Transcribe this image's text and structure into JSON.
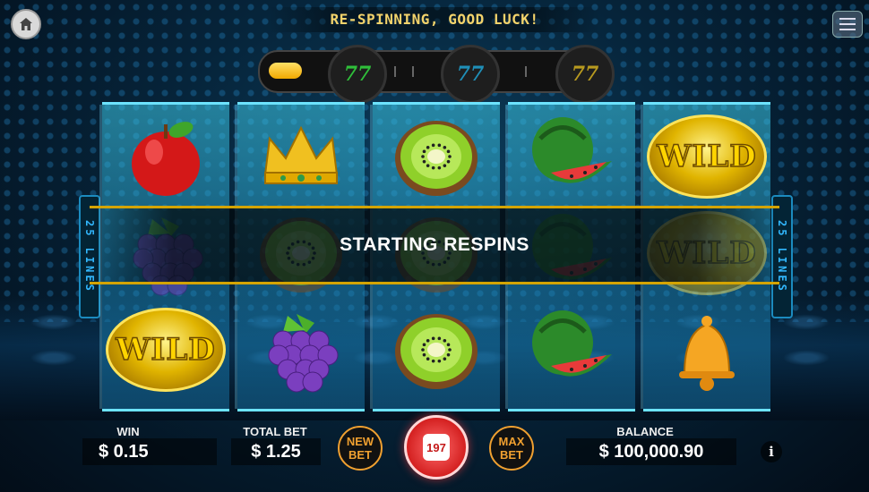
{
  "header": {
    "message": "RE-SPINNING, GOOD LUCK!",
    "home_icon": "home-icon",
    "menu_icon": "hamburger-menu-icon"
  },
  "respin_progress": {
    "fill_fraction": 0.1,
    "markers": [
      {
        "label": "77",
        "color": "#2fbf3a"
      },
      {
        "label": "77",
        "color": "#1f8fb8"
      },
      {
        "label": "77",
        "color": "#b89a1f"
      }
    ]
  },
  "reels": [
    [
      "apple",
      "grapes",
      "wild"
    ],
    [
      "crown",
      "kiwi",
      "grapes"
    ],
    [
      "kiwi",
      "kiwi",
      "kiwi"
    ],
    [
      "watermelon",
      "watermelon",
      "watermelon"
    ],
    [
      "wild",
      "wild",
      "bell"
    ]
  ],
  "wild_label": "WILD",
  "paylines_label": "25 LINES",
  "banner": {
    "text": "STARTING RESPINS"
  },
  "footer": {
    "win_label": "WIN",
    "win_value": "$ 0.15",
    "total_bet_label": "TOTAL BET",
    "total_bet_value": "$ 1.25",
    "new_bet": [
      "NEW",
      "BET"
    ],
    "max_bet": [
      "MAX",
      "BET"
    ],
    "spin_count": "197",
    "balance_label": "BALANCE",
    "balance_value": "$ 100,000.90",
    "info_label": "i"
  },
  "colors": {
    "accent_gold": "#f3d36b",
    "reel_glow": "#6de3ff",
    "spin_red": "#d42020",
    "bet_orange": "#f0a030"
  }
}
